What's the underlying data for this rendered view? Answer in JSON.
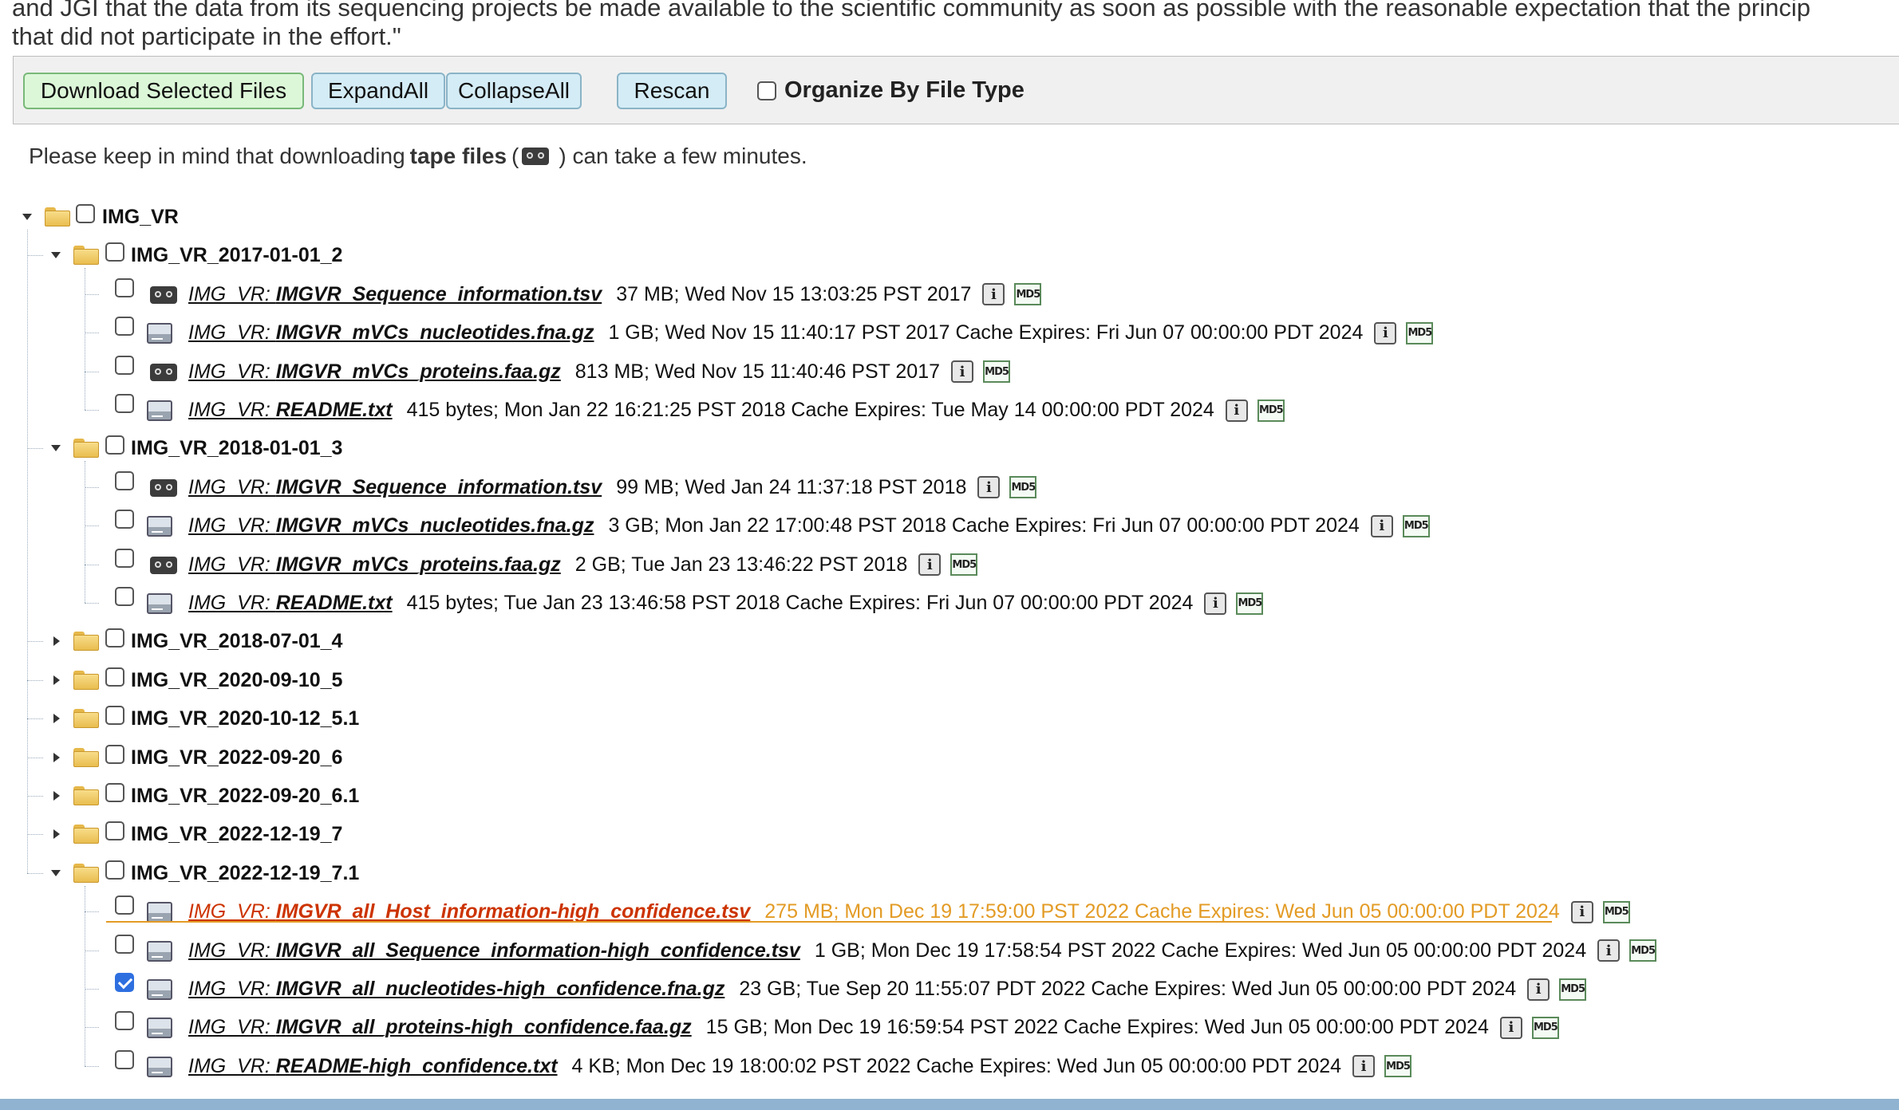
{
  "intro": {
    "line1": "and JGI that the data from its sequencing projects be made available to the scientific community as soon as possible with the reasonable expectation that the princip",
    "line2": "that did not participate in the effort.\""
  },
  "toolbar": {
    "download_label": "Download Selected Files",
    "expand_label": "ExpandAll",
    "collapse_label": "CollapseAll",
    "rescan_label": "Rescan",
    "organize_label": "Organize By File Type",
    "organize_checked": false
  },
  "notice": {
    "before": "Please keep in mind that downloading",
    "bold": "tape files",
    "open_paren": "(",
    "after": ") can take a few minutes."
  },
  "icons": {
    "info": "i",
    "md5": "MD5"
  },
  "tree": {
    "root": {
      "name": "IMG_VR",
      "expanded": true,
      "checked": false
    },
    "folders": [
      {
        "name": "IMG_VR_2017-01-01_2",
        "expanded": true,
        "checked": false,
        "files": [
          {
            "prefix": "IMG_VR: ",
            "name": "IMGVR_Sequence_information.tsv",
            "meta": "37 MB;  Wed Nov 15 13:03:25 PST 2017",
            "storage": "tape",
            "checked": false
          },
          {
            "prefix": "IMG_VR: ",
            "name": "IMGVR_mVCs_nucleotides.fna.gz",
            "meta": "1 GB;  Wed Nov 15 11:40:17 PST 2017  Cache Expires: Fri Jun 07 00:00:00 PDT 2024",
            "storage": "disk",
            "checked": false
          },
          {
            "prefix": "IMG_VR: ",
            "name": "IMGVR_mVCs_proteins.faa.gz",
            "meta": "813 MB;  Wed Nov 15 11:40:46 PST 2017",
            "storage": "tape",
            "checked": false
          },
          {
            "prefix": "IMG_VR: ",
            "name": "README.txt",
            "meta": "415 bytes;  Mon Jan 22 16:21:25 PST 2018  Cache Expires: Tue May 14 00:00:00 PDT 2024",
            "storage": "disk",
            "checked": false
          }
        ]
      },
      {
        "name": "IMG_VR_2018-01-01_3",
        "expanded": true,
        "checked": false,
        "files": [
          {
            "prefix": "IMG_VR: ",
            "name": "IMGVR_Sequence_information.tsv",
            "meta": "99 MB;  Wed Jan 24 11:37:18 PST 2018",
            "storage": "tape",
            "checked": false
          },
          {
            "prefix": "IMG_VR: ",
            "name": "IMGVR_mVCs_nucleotides.fna.gz",
            "meta": "3 GB;  Mon Jan 22 17:00:48 PST 2018  Cache Expires: Fri Jun 07 00:00:00 PDT 2024",
            "storage": "disk",
            "checked": false
          },
          {
            "prefix": "IMG_VR: ",
            "name": "IMGVR_mVCs_proteins.faa.gz",
            "meta": "2 GB;  Tue Jan 23 13:46:22 PST 2018",
            "storage": "tape",
            "checked": false
          },
          {
            "prefix": "IMG_VR: ",
            "name": "README.txt",
            "meta": "415 bytes;  Tue Jan 23 13:46:58 PST 2018  Cache Expires: Fri Jun 07 00:00:00 PDT 2024",
            "storage": "disk",
            "checked": false
          }
        ]
      },
      {
        "name": "IMG_VR_2018-07-01_4",
        "expanded": false,
        "checked": false,
        "files": []
      },
      {
        "name": "IMG_VR_2020-09-10_5",
        "expanded": false,
        "checked": false,
        "files": []
      },
      {
        "name": "IMG_VR_2020-10-12_5.1",
        "expanded": false,
        "checked": false,
        "files": []
      },
      {
        "name": "IMG_VR_2022-09-20_6",
        "expanded": false,
        "checked": false,
        "files": []
      },
      {
        "name": "IMG_VR_2022-09-20_6.1",
        "expanded": false,
        "checked": false,
        "files": []
      },
      {
        "name": "IMG_VR_2022-12-19_7",
        "expanded": false,
        "checked": false,
        "files": []
      },
      {
        "name": "IMG_VR_2022-12-19_7.1",
        "expanded": true,
        "checked": false,
        "files": [
          {
            "prefix": "IMG_VR: ",
            "name": "IMGVR_all_Host_information-high_confidence.tsv",
            "meta": "275 MB;  Mon Dec 19 17:59:00 PST 2022  Cache Expires: Wed Jun 05 00:00:00 PDT 2024",
            "storage": "disk",
            "checked": false,
            "hover": true
          },
          {
            "prefix": "IMG_VR: ",
            "name": "IMGVR_all_Sequence_information-high_confidence.tsv",
            "meta": "1 GB;  Mon Dec 19 17:58:54 PST 2022  Cache Expires: Wed Jun 05 00:00:00 PDT 2024",
            "storage": "disk",
            "checked": false
          },
          {
            "prefix": "IMG_VR: ",
            "name": "IMGVR_all_nucleotides-high_confidence.fna.gz",
            "meta": "23 GB;  Tue Sep 20 11:55:07 PDT 2022  Cache Expires: Wed Jun 05 00:00:00 PDT 2024",
            "storage": "disk",
            "checked": true
          },
          {
            "prefix": "IMG_VR: ",
            "name": "IMGVR_all_proteins-high_confidence.faa.gz",
            "meta": "15 GB;  Mon Dec 19 16:59:54 PST 2022  Cache Expires: Wed Jun 05 00:00:00 PDT 2024",
            "storage": "disk",
            "checked": false
          },
          {
            "prefix": "IMG_VR: ",
            "name": "README-high_confidence.txt",
            "meta": "4 KB;  Mon Dec 19 18:00:02 PST 2022  Cache Expires: Wed Jun 05 00:00:00 PDT 2024",
            "storage": "disk",
            "checked": false
          }
        ]
      }
    ]
  }
}
